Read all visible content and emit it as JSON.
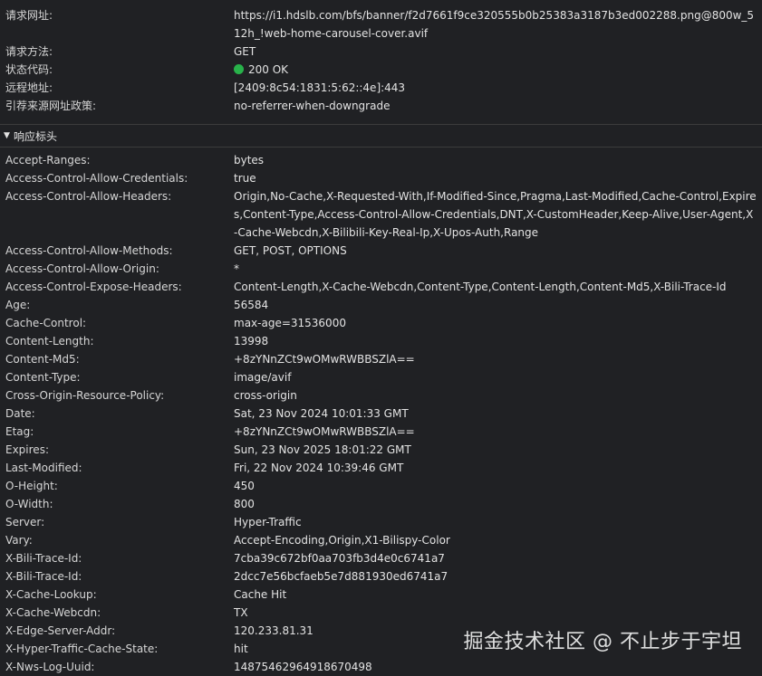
{
  "general": [
    {
      "key": "请求网址:",
      "value": "https://i1.hdslb.com/bfs/banner/f2d7661f9ce320555b0b25383a3187b3ed002288.png@800w_512h_!web-home-carousel-cover.avif"
    },
    {
      "key": "请求方法:",
      "value": "GET"
    },
    {
      "key": "状态代码:",
      "value": "200 OK"
    },
    {
      "key": "远程地址:",
      "value": "[2409:8c54:1831:5:62::4e]:443"
    },
    {
      "key": "引荐来源网址政策:",
      "value": "no-referrer-when-downgrade"
    }
  ],
  "status_color": "#28b24a",
  "response_section": {
    "title": "响应标头"
  },
  "response_headers": [
    {
      "key": "Accept-Ranges:",
      "value": "bytes"
    },
    {
      "key": "Access-Control-Allow-Credentials:",
      "value": "true"
    },
    {
      "key": "Access-Control-Allow-Headers:",
      "value": "Origin,No-Cache,X-Requested-With,If-Modified-Since,Pragma,Last-Modified,Cache-Control,Expires,Content-Type,Access-Control-Allow-Credentials,DNT,X-CustomHeader,Keep-Alive,User-Agent,X-Cache-Webcdn,X-Bilibili-Key-Real-Ip,X-Upos-Auth,Range"
    },
    {
      "key": "Access-Control-Allow-Methods:",
      "value": "GET, POST, OPTIONS"
    },
    {
      "key": "Access-Control-Allow-Origin:",
      "value": "*"
    },
    {
      "key": "Access-Control-Expose-Headers:",
      "value": "Content-Length,X-Cache-Webcdn,Content-Type,Content-Length,Content-Md5,X-Bili-Trace-Id"
    },
    {
      "key": "Age:",
      "value": "56584"
    },
    {
      "key": "Cache-Control:",
      "value": "max-age=31536000"
    },
    {
      "key": "Content-Length:",
      "value": "13998"
    },
    {
      "key": "Content-Md5:",
      "value": "+8zYNnZCt9wOMwRWBBSZlA=="
    },
    {
      "key": "Content-Type:",
      "value": "image/avif"
    },
    {
      "key": "Cross-Origin-Resource-Policy:",
      "value": "cross-origin"
    },
    {
      "key": "Date:",
      "value": "Sat, 23 Nov 2024 10:01:33 GMT"
    },
    {
      "key": "Etag:",
      "value": "+8zYNnZCt9wOMwRWBBSZlA=="
    },
    {
      "key": "Expires:",
      "value": "Sun, 23 Nov 2025 18:01:22 GMT"
    },
    {
      "key": "Last-Modified:",
      "value": "Fri, 22 Nov 2024 10:39:46 GMT"
    },
    {
      "key": "O-Height:",
      "value": "450"
    },
    {
      "key": "O-Width:",
      "value": "800"
    },
    {
      "key": "Server:",
      "value": "Hyper-Traffic"
    },
    {
      "key": "Vary:",
      "value": "Accept-Encoding,Origin,X1-Bilispy-Color"
    },
    {
      "key": "X-Bili-Trace-Id:",
      "value": "7cba39c672bf0aa703fb3d4e0c6741a7"
    },
    {
      "key": "X-Bili-Trace-Id:",
      "value": "2dcc7e56bcfaeb5e7d881930ed6741a7"
    },
    {
      "key": "X-Cache-Lookup:",
      "value": "Cache Hit"
    },
    {
      "key": "X-Cache-Webcdn:",
      "value": "TX"
    },
    {
      "key": "X-Edge-Server-Addr:",
      "value": "120.233.81.31"
    },
    {
      "key": "X-Hyper-Traffic-Cache-State:",
      "value": "hit"
    },
    {
      "key": "X-Nws-Log-Uuid:",
      "value": "14875462964918670498"
    }
  ],
  "watermark": "掘金技术社区 @ 不止步于宇坦"
}
